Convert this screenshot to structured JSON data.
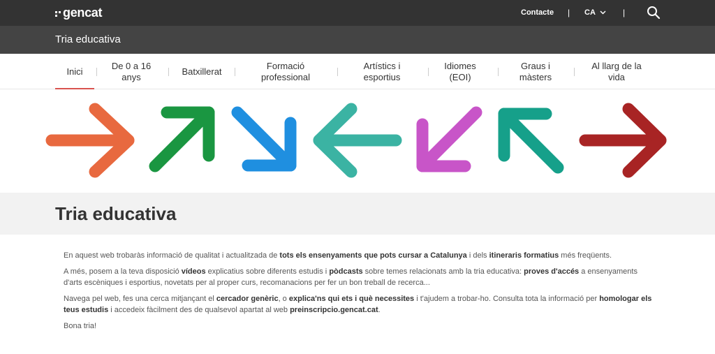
{
  "header": {
    "logo_text": "gencat",
    "contact_label": "Contacte",
    "language": "CA",
    "separator": "|"
  },
  "subheader": {
    "title": "Tria educativa"
  },
  "nav": {
    "items": [
      {
        "label": "Inici",
        "active": true
      },
      {
        "label": "De 0 a 16 anys",
        "active": false
      },
      {
        "label": "Batxillerat",
        "active": false
      },
      {
        "label": "Formació professional",
        "active": false
      },
      {
        "label": "Artístics i esportius",
        "active": false
      },
      {
        "label": "Idiomes (EOI)",
        "active": false
      },
      {
        "label": "Graus i màsters",
        "active": false
      },
      {
        "label": "Al llarg de la vida",
        "active": false
      }
    ]
  },
  "banner": {
    "arrows": [
      {
        "name": "arrow-right-orange-icon",
        "color": "#e8693f"
      },
      {
        "name": "arrow-up-right-green-icon",
        "color": "#1a9641"
      },
      {
        "name": "arrow-down-right-blue-icon",
        "color": "#1f8fe0"
      },
      {
        "name": "arrow-left-teal-icon",
        "color": "#3bb3a3"
      },
      {
        "name": "arrow-down-left-purple-icon",
        "color": "#c855c8"
      },
      {
        "name": "arrow-up-left-teal-icon",
        "color": "#16a08a"
      },
      {
        "name": "arrow-right-red-icon",
        "color": "#a82424"
      }
    ]
  },
  "main": {
    "title": "Tria educativa",
    "p1": {
      "a": "En aquest web trobaràs informació de qualitat i actualitzada de ",
      "b": "tots els ensenyaments que pots cursar a Catalunya",
      "c": " i dels ",
      "d": "itineraris formatius",
      "e": " més freqüents."
    },
    "p2": {
      "a": "A més, posem a la teva disposició ",
      "b": "vídeos",
      "c": " explicatius sobre diferents estudis i ",
      "d": "pòdcasts",
      "e": " sobre temes relacionats amb la tria educativa: ",
      "f": "proves d'accés",
      "g": " a ensenyaments d'arts escèniques i esportius, novetats per al proper curs, recomanacions per fer un bon treball de recerca..."
    },
    "p3": {
      "a": "Navega pel web, fes una cerca mitjançant el ",
      "b": "cercador genèric",
      "c": ", o ",
      "d": "explica'ns qui ets i què necessites",
      "e": " i t'ajudem a trobar-ho. Consulta tota la informació per ",
      "f": "homologar els teus estudis",
      "g": " i accedeix fàcilment des de qualsevol apartat al web ",
      "h": "preinscripcio.gencat.cat",
      "i": "."
    },
    "p4": "Bona tria!"
  }
}
